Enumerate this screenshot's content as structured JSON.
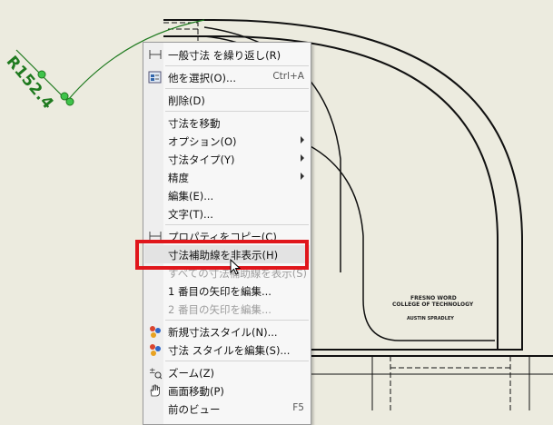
{
  "drawing": {
    "dimension_label": "R152.4",
    "title_block": {
      "line1": "FRESNO WORD",
      "line2": "COLLEGE OF TECHNOLOGY",
      "line3": "AUSTIN SPRADLEY"
    }
  },
  "context_menu": {
    "items": [
      {
        "label": "一般寸法 を繰り返し(R)",
        "icon": "dimension-icon"
      },
      {
        "label": "他を選択(O)...",
        "shortcut": "Ctrl+A",
        "icon": "select-other-icon"
      },
      {
        "label": "削除(D)"
      },
      {
        "label": "寸法を移動"
      },
      {
        "label": "オプション(O)"
      },
      {
        "label": "寸法タイプ(Y)"
      },
      {
        "label": "精度"
      },
      {
        "label": "編集(E)..."
      },
      {
        "label": "文字(T)..."
      },
      {
        "label": "プロパティをコピー(C)",
        "icon": "copy-properties-icon"
      },
      {
        "label": "寸法補助線を非表示(H)"
      },
      {
        "label": "すべての寸法補助線を表示(S)"
      },
      {
        "label": "1 番目の矢印を編集..."
      },
      {
        "label": "2 番目の矢印を編集..."
      },
      {
        "label": "新規寸法スタイル(N)...",
        "icon": "style-icon"
      },
      {
        "label": "寸法 スタイルを編集(S)...",
        "icon": "style-icon"
      },
      {
        "label": "ズーム(Z)",
        "icon": "zoom-icon"
      },
      {
        "label": "画面移動(P)",
        "icon": "pan-hand-icon"
      },
      {
        "label": "前のビュー",
        "shortcut": "F5"
      }
    ]
  },
  "colors": {
    "canvas": "#ecebdf",
    "dimension": "#1f7a1f",
    "highlight_box": "#e0161b"
  }
}
